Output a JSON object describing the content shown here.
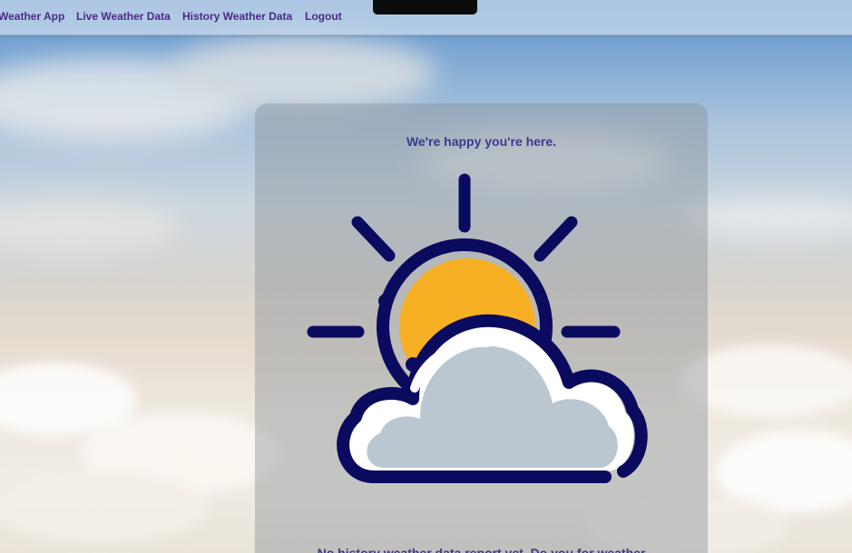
{
  "nav": {
    "brand": "Weather App",
    "links": [
      "Live Weather Data",
      "History Weather Data",
      "Logout"
    ]
  },
  "card": {
    "welcome": "We're happy you're here.",
    "illustration": "partly-cloudy-icon",
    "bottom_text": "No history weather data report yet. Do you for weather"
  },
  "colors": {
    "nav_text": "#4b2a86",
    "heading_text": "#3b3a8c",
    "icon_stroke": "#0a0a5e",
    "sun_fill": "#f7b024",
    "cloud_fill": "#bac7d1"
  }
}
